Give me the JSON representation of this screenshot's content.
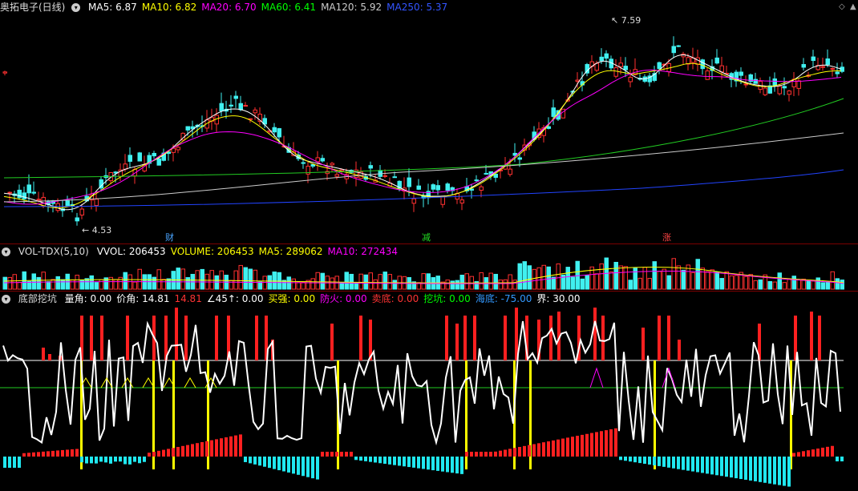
{
  "main": {
    "title": "奥拓电子(日线)",
    "ma": [
      {
        "label": "MA5",
        "value": "6.87",
        "color": "#ffffff"
      },
      {
        "label": "MA10",
        "value": "6.82",
        "color": "#ffff00"
      },
      {
        "label": "MA20",
        "value": "6.70",
        "color": "#ff00ff"
      },
      {
        "label": "MA60",
        "value": "6.41",
        "color": "#00ff00"
      },
      {
        "label": "MA120",
        "value": "5.92",
        "color": "#cccccc"
      },
      {
        "label": "MA250",
        "value": "5.37",
        "color": "#3355ff"
      }
    ],
    "high_label": "7.59",
    "low_label": "4.53",
    "markers": [
      "财",
      "减",
      "涨"
    ]
  },
  "volume": {
    "title": "VOL-TDX(5,10)",
    "items": [
      {
        "label": "VVOL",
        "value": "206453",
        "color": "#ffffff"
      },
      {
        "label": "VOLUME",
        "value": "206453",
        "color": "#ffff00"
      },
      {
        "label": "MA5",
        "value": "289062",
        "color": "#ffff00"
      },
      {
        "label": "MA10",
        "value": "272434",
        "color": "#ff00ff"
      }
    ]
  },
  "indicator": {
    "title": "底部挖坑",
    "items": [
      {
        "label": "量角",
        "value": "0.00",
        "color": "#ffffff"
      },
      {
        "label": "价角",
        "value": "14.81",
        "color": "#ffffff"
      },
      {
        "label": "",
        "value": "14.81",
        "color": "#ff3333"
      },
      {
        "label": "∠45↑",
        "value": "0.00",
        "color": "#ffffff"
      },
      {
        "label": "买强",
        "value": "0.00",
        "color": "#ffff00"
      },
      {
        "label": "防火",
        "value": "0.00",
        "color": "#ff00ff"
      },
      {
        "label": "卖底",
        "value": "0.00",
        "color": "#ff3333"
      },
      {
        "label": "挖坑",
        "value": "0.00",
        "color": "#00ff00"
      },
      {
        "label": "海底",
        "value": "-75.00",
        "color": "#3399ff"
      },
      {
        "label": "界",
        "value": "30.00",
        "color": "#ffffff"
      }
    ]
  },
  "icons": {
    "header": "circle-icon",
    "corner_up": "triangle-up-icon",
    "corner_diamond": "diamond-icon"
  }
}
